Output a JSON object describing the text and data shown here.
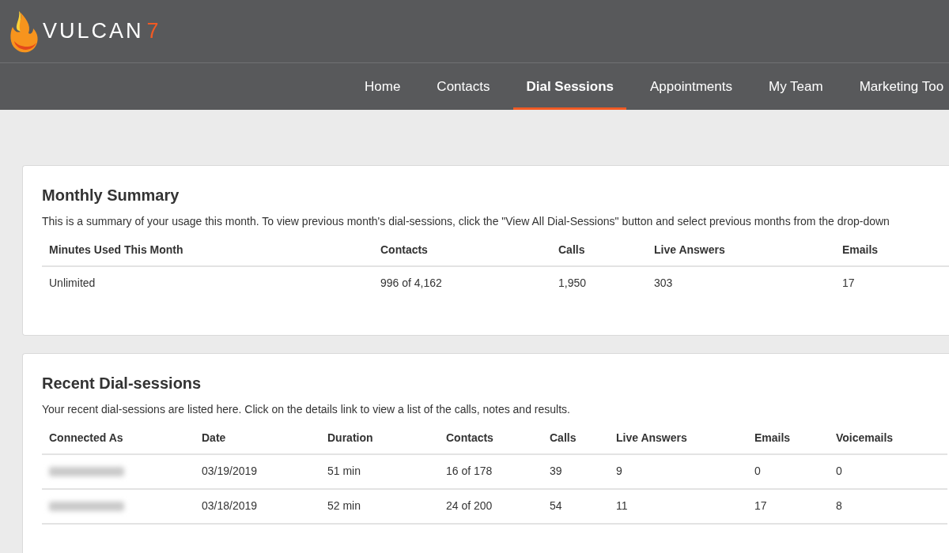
{
  "logo": {
    "word": "VULCAN",
    "number": "7"
  },
  "nav": [
    {
      "label": "Home",
      "selected": false
    },
    {
      "label": "Contacts",
      "selected": false
    },
    {
      "label": "Dial Sessions",
      "selected": true
    },
    {
      "label": "Appointments",
      "selected": false
    },
    {
      "label": "My Team",
      "selected": false
    },
    {
      "label": "Marketing Too",
      "selected": false
    }
  ],
  "monthly_summary": {
    "title": "Monthly Summary",
    "description": "This is a summary of your usage this month. To view previous month's dial-sessions, click the \"View All Dial-Sessions\" button and select previous months from the drop-down",
    "columns": [
      "Minutes Used This Month",
      "Contacts",
      "Calls",
      "Live Answers",
      "Emails"
    ],
    "rows": [
      {
        "cells": [
          "Unlimited",
          "996 of 4,162",
          "1,950",
          "303",
          "17"
        ]
      }
    ]
  },
  "recent_sessions": {
    "title": "Recent Dial-sessions",
    "description": "Your recent dial-sessions are listed here. Click on the details link to view a list of the calls, notes and results.",
    "columns": [
      "Connected As",
      "Date",
      "Duration",
      "Contacts",
      "Calls",
      "Live Answers",
      "Emails",
      "Voicemails"
    ],
    "rows": [
      {
        "connected_as_redacted": true,
        "cells": [
          "",
          "03/19/2019",
          "51 min",
          "16 of 178",
          "39",
          "9",
          "0",
          "0"
        ]
      },
      {
        "connected_as_redacted": true,
        "cells": [
          "",
          "03/18/2019",
          "52 min",
          "24 of 200",
          "54",
          "11",
          "17",
          "8"
        ]
      }
    ]
  }
}
